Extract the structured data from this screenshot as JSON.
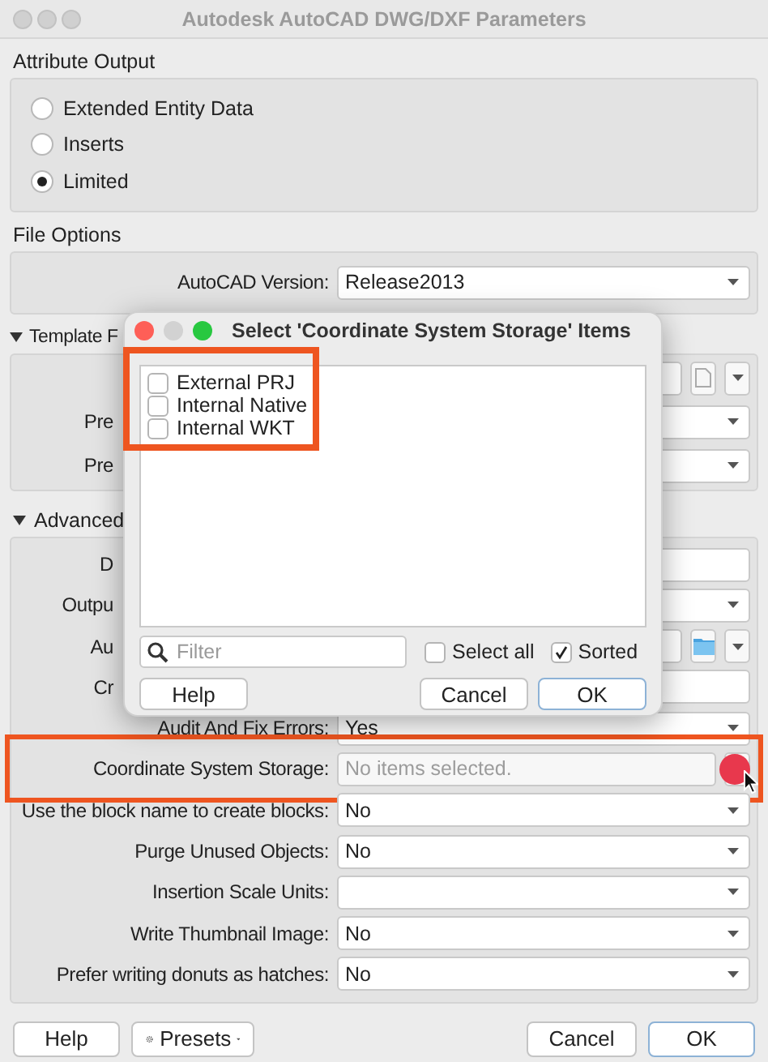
{
  "window": {
    "title": "Autodesk AutoCAD DWG/DXF Parameters"
  },
  "attribute_output": {
    "title": "Attribute Output",
    "options": [
      {
        "label": "Extended Entity Data",
        "selected": false
      },
      {
        "label": "Inserts",
        "selected": false
      },
      {
        "label": "Limited",
        "selected": true
      }
    ]
  },
  "file_options": {
    "title": "File Options",
    "rows": [
      {
        "kind": "combo",
        "label": "AutoCAD Version:",
        "value": "Release2013"
      }
    ]
  },
  "template_section": {
    "title": "Template F",
    "expanded": true,
    "rows": [
      {
        "kind": "document_picker"
      },
      {
        "kind": "combo",
        "label": "Pre",
        "under_dialog": true
      },
      {
        "kind": "combo",
        "label": "Pre",
        "under_dialog": true
      }
    ]
  },
  "advanced": {
    "title": "Advanced",
    "expanded": true,
    "rows": [
      {
        "kind": "text",
        "label": "D",
        "under_dialog": true
      },
      {
        "kind": "combo",
        "label": "Outpu",
        "under_dialog": true
      },
      {
        "kind": "folder_picker",
        "label": "Au",
        "under_dialog": true
      },
      {
        "kind": "text",
        "label": "Cr",
        "under_dialog": true
      },
      {
        "kind": "combo",
        "label": "Audit And Fix Errors:",
        "value": "Yes"
      },
      {
        "kind": "list",
        "label": "Coordinate System Storage:",
        "placeholder": "No items selected.",
        "highlighted": true,
        "marker": true
      },
      {
        "kind": "combo",
        "label": "Use the block name to create blocks:",
        "value": "No"
      },
      {
        "kind": "combo",
        "label": "Purge Unused Objects:",
        "value": "No"
      },
      {
        "kind": "combo",
        "label": "Insertion Scale Units:"
      },
      {
        "kind": "combo",
        "label": "Write Thumbnail Image:",
        "value": "No"
      },
      {
        "kind": "combo",
        "label": "Prefer writing donuts as hatches:",
        "value": "No"
      }
    ]
  },
  "buttons": {
    "help": "Help",
    "presets": "Presets",
    "cancel": "Cancel",
    "ok": "OK"
  },
  "selection_dialog": {
    "title": "Select 'Coordinate System Storage' Items",
    "items_highlighted": true,
    "items": [
      {
        "label": "External PRJ",
        "checked": false
      },
      {
        "label": "Internal Native",
        "checked": false
      },
      {
        "label": "Internal WKT",
        "checked": false
      }
    ],
    "filter_placeholder": "Filter",
    "select_all": {
      "label": "Select all",
      "checked": false
    },
    "sorted": {
      "label": "Sorted",
      "checked": true
    },
    "buttons": {
      "help": "Help",
      "cancel": "Cancel",
      "ok": "OK"
    }
  }
}
